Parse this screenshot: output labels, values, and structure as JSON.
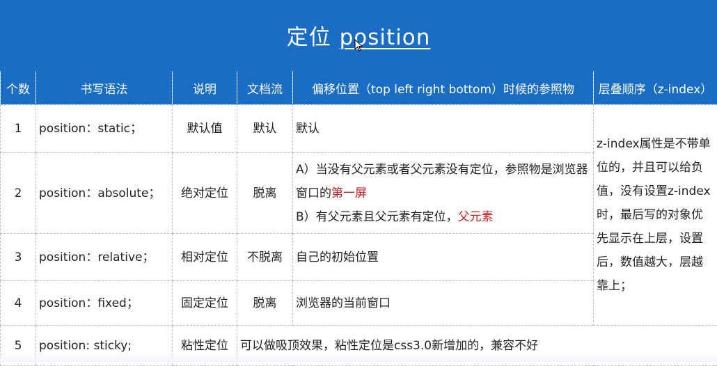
{
  "title": {
    "main": "定位",
    "link": "position"
  },
  "headers": {
    "count": "个数",
    "syntax": "书写语法",
    "desc": "说明",
    "flow": "文档流",
    "offset_ref": "偏移位置（top left right bottom）时候的参照物",
    "zindex": "层叠顺序（z-index）"
  },
  "rows": [
    {
      "num": "1",
      "syntax": "position：static；",
      "desc": "默认值",
      "flow": "默认",
      "ref": "默认"
    },
    {
      "num": "2",
      "syntax": "position：absolute；",
      "desc": "绝对定位",
      "flow": "脱离",
      "ref_a_prefix": "A）当没有父元素或者父元素没有定位，参照物是浏览器窗口的",
      "ref_a_highlight": "第一屏",
      "ref_b_prefix": "B）有父元素且父元素有定位，",
      "ref_b_highlight": "父元素"
    },
    {
      "num": "3",
      "syntax": "position：relative；",
      "desc": "相对定位",
      "flow": "不脱离",
      "ref": "自己的初始位置"
    },
    {
      "num": "4",
      "syntax": "position：fixed；",
      "desc": "固定定位",
      "flow": "脱离",
      "ref": "浏览器的当前窗口"
    },
    {
      "num": "5",
      "syntax": "position: sticky;",
      "desc": "粘性定位",
      "note": "可以做吸顶效果，粘性定位是css3.0新增加的，兼容不好"
    }
  ],
  "zindex_note": "z-index属性是不带单位的，并且可以给负值，没有设置z-index时，最后写的对象优先显示在上层，设置后，数值越大，层越靠上；",
  "colors": {
    "header_bg": "#1a6dc4",
    "highlight": "#d21f1f"
  }
}
